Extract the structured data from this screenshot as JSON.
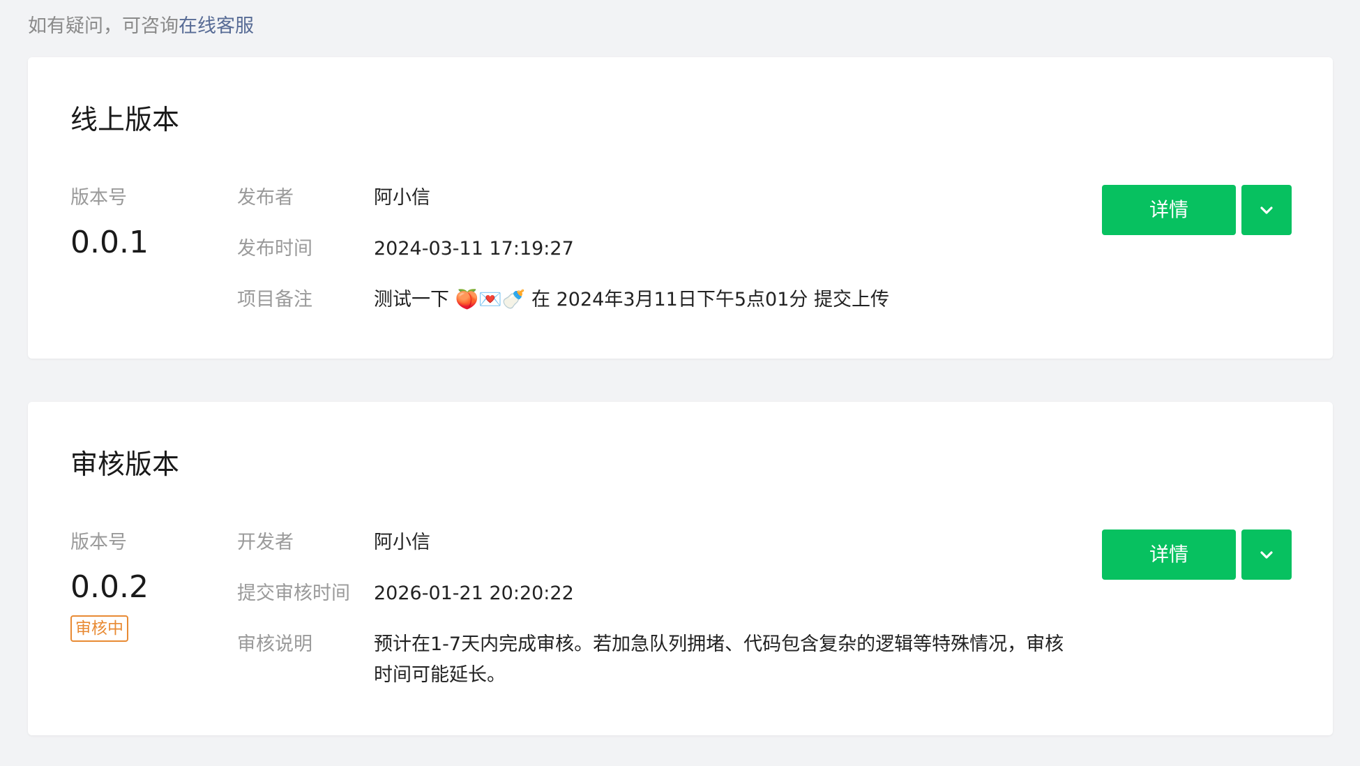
{
  "hint": {
    "prefix": "如有疑问，可咨询",
    "link": "在线客服"
  },
  "online": {
    "title": "线上版本",
    "version_label": "版本号",
    "version": "0.0.1",
    "rows": [
      {
        "key": "发布者",
        "value": "阿小信"
      },
      {
        "key": "发布时间",
        "value": "2024-03-11 17:19:27"
      },
      {
        "key": "项目备注",
        "value": "测试一下 🍑💌🍼 在 2024年3月11日下午5点01分 提交上传"
      }
    ],
    "detail_label": "详情",
    "more_icon": "chevron-down-icon"
  },
  "review": {
    "title": "审核版本",
    "version_label": "版本号",
    "version": "0.0.2",
    "status": "审核中",
    "rows": [
      {
        "key": "开发者",
        "value": "阿小信"
      },
      {
        "key": "提交审核时间",
        "value": "2026-01-21 20:20:22"
      },
      {
        "key": "审核说明",
        "value": "预计在1-7天内完成审核。若加急队列拥堵、代码包含复杂的逻辑等特殊情况，审核时间可能延长。"
      }
    ],
    "detail_label": "详情",
    "more_icon": "chevron-down-icon"
  },
  "colors": {
    "primary": "#07c160",
    "link": "#576b95",
    "status": "#e88a33",
    "background": "#f2f3f5"
  }
}
